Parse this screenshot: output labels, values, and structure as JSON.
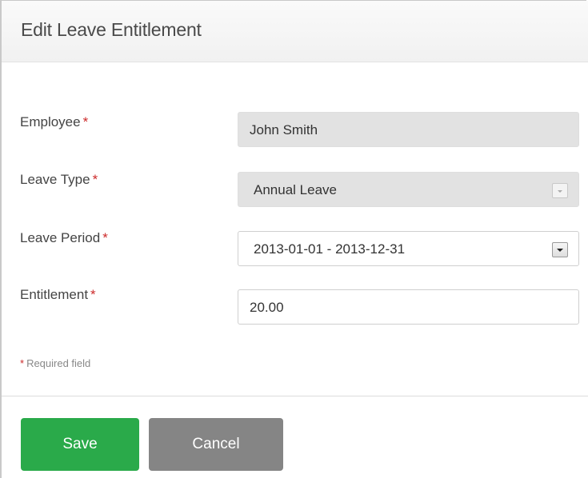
{
  "dialog": {
    "title": "Edit Leave Entitlement"
  },
  "form": {
    "required_mark": "*",
    "employee": {
      "label": "Employee",
      "value": "John Smith"
    },
    "leave_type": {
      "label": "Leave Type",
      "value": "Annual Leave"
    },
    "leave_period": {
      "label": "Leave Period",
      "value": "2013-01-01 - 2013-12-31"
    },
    "entitlement": {
      "label": "Entitlement",
      "value": "20.00"
    },
    "required_note": "Required field"
  },
  "actions": {
    "save_label": "Save",
    "cancel_label": "Cancel"
  },
  "colors": {
    "save_button": "#2aaa4a",
    "cancel_button": "#858585",
    "required_star": "#cc2a2a",
    "disabled_field": "#e2e2e2"
  },
  "icons": {
    "select_arrow": "chevron-down-icon"
  }
}
